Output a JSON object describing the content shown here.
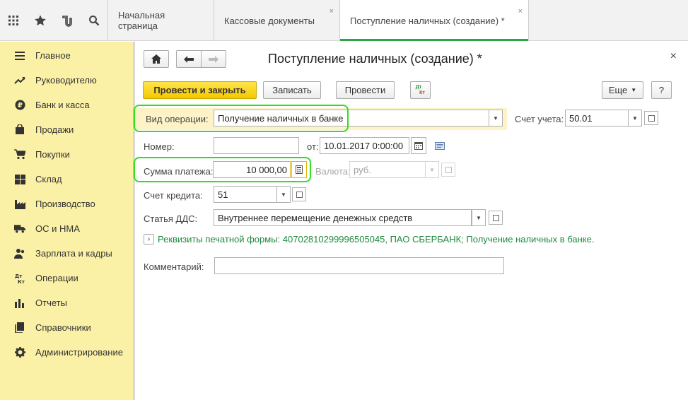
{
  "topbar": {
    "icons": [
      "apps-grid-icon",
      "star-icon",
      "history-icon",
      "search-icon"
    ],
    "tabs": [
      {
        "label": "Начальная страница",
        "closable": false,
        "active": false
      },
      {
        "label": "Кассовые документы",
        "closable": true,
        "active": false
      },
      {
        "label": "Поступление наличных (создание) *",
        "closable": true,
        "active": true
      }
    ],
    "close_glyph": "×"
  },
  "sidebar": {
    "items": [
      {
        "label": "Главное",
        "icon": "menu-lines-icon"
      },
      {
        "label": "Руководителю",
        "icon": "trend-icon"
      },
      {
        "label": "Банк и касса",
        "icon": "ruble-coin-icon"
      },
      {
        "label": "Продажи",
        "icon": "bag-icon"
      },
      {
        "label": "Покупки",
        "icon": "cart-icon"
      },
      {
        "label": "Склад",
        "icon": "warehouse-icon"
      },
      {
        "label": "Производство",
        "icon": "factory-icon"
      },
      {
        "label": "ОС и НМА",
        "icon": "truck-icon"
      },
      {
        "label": "Зарплата и кадры",
        "icon": "people-icon"
      },
      {
        "label": "Операции",
        "icon": "dt-kt-icon"
      },
      {
        "label": "Отчеты",
        "icon": "bar-chart-icon"
      },
      {
        "label": "Справочники",
        "icon": "books-icon"
      },
      {
        "label": "Администрирование",
        "icon": "gear-icon"
      }
    ]
  },
  "form": {
    "title": "Поступление наличных (создание) *",
    "close": "×",
    "toolbar": {
      "post_close": "Провести и закрыть",
      "save": "Записать",
      "post": "Провести",
      "dtkt_top": "Дт",
      "dtkt_bottom": "Кт",
      "more": "Еще",
      "help": "?"
    },
    "operation_type": {
      "label": "Вид операции:",
      "value": "Получение наличных в банке"
    },
    "account": {
      "label": "Счет учета:",
      "value": "50.01"
    },
    "number": {
      "label": "Номер:",
      "value": ""
    },
    "date": {
      "label": "от:",
      "value": "10.01.2017  0:00:00"
    },
    "amount": {
      "label": "Сумма платежа:",
      "value": "10 000,00"
    },
    "currency": {
      "label": "Валюта:",
      "value": "руб."
    },
    "credit_account": {
      "label": "Счет кредита:",
      "value": "51"
    },
    "dds": {
      "label": "Статья ДДС:",
      "value": "Внутреннее перемещение денежных средств"
    },
    "print_link": "Реквизиты печатной формы: 40702810299996505045, ПАО СБЕРБАНК; Получение наличных в банке.",
    "comment": {
      "label": "Комментарий:",
      "value": ""
    }
  },
  "colors": {
    "highlight": "#33dd22",
    "sidebar": "#fbf1a6",
    "link": "#1f8a3c",
    "primary": "#f5c800"
  }
}
